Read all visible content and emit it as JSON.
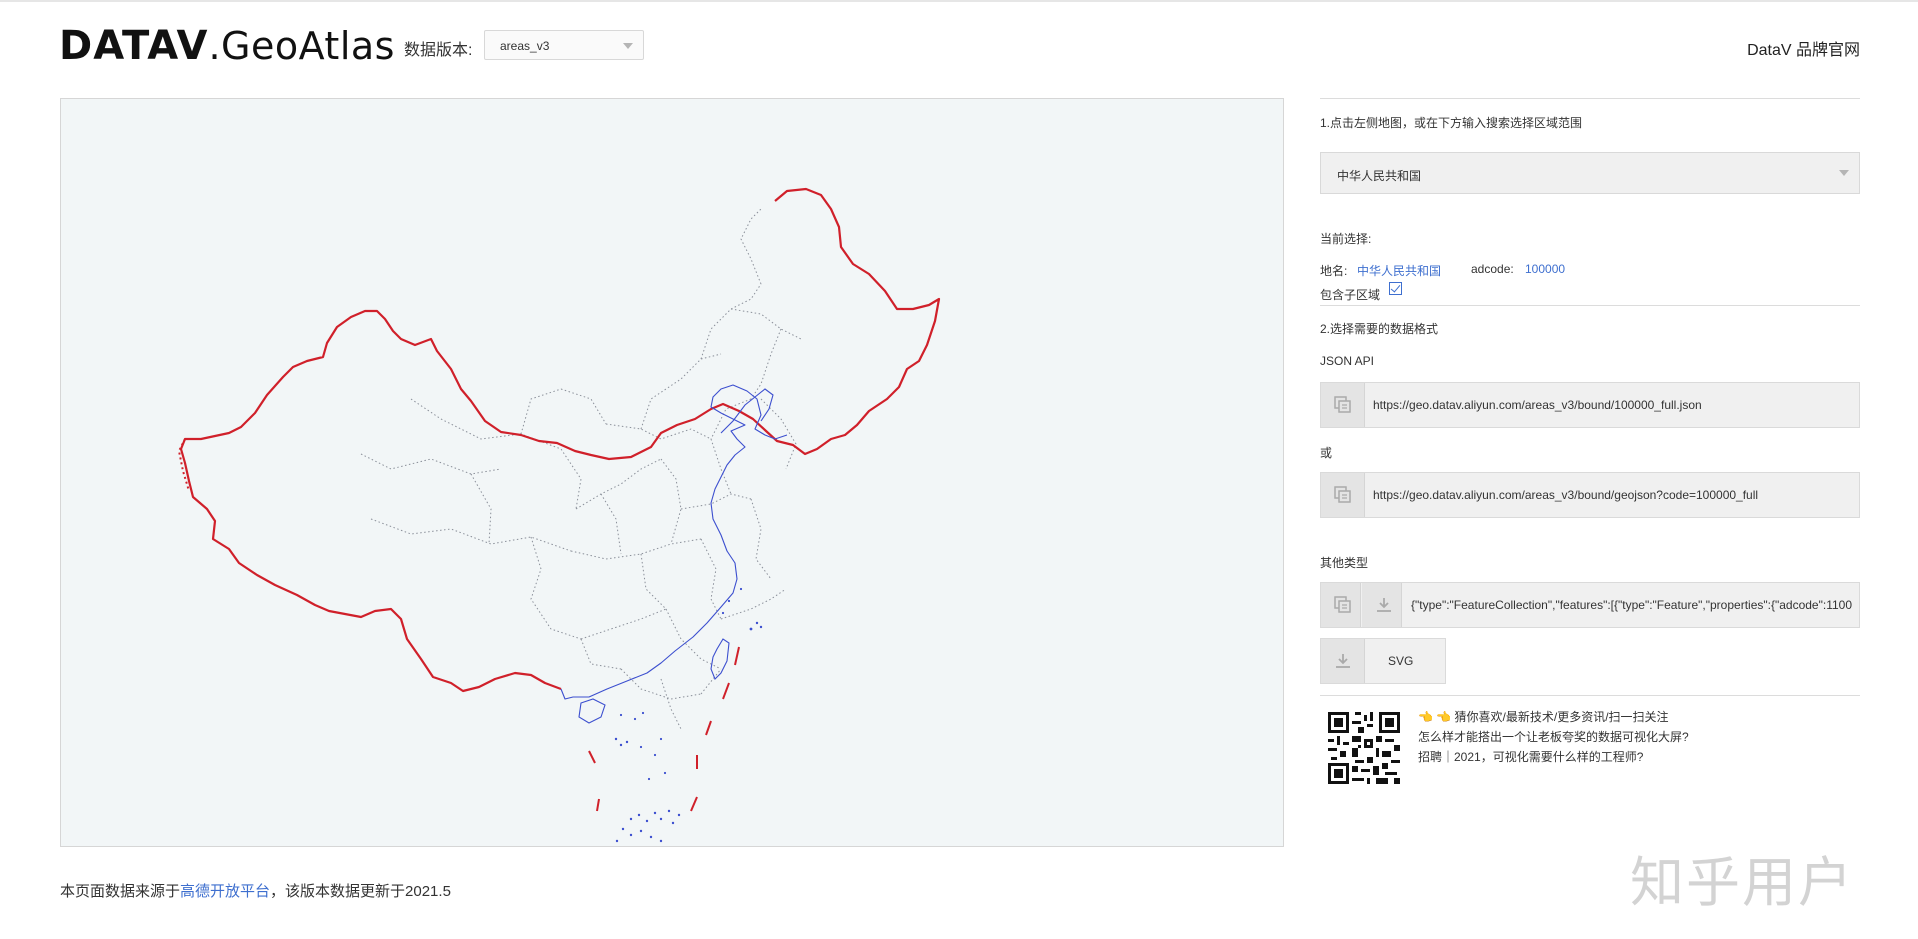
{
  "header": {
    "logo_bold": "DATAV",
    "logo_light": ".GeoAtlas",
    "version_label": "数据版本:",
    "version_value": "areas_v3",
    "brand_link": "DataV 品牌官网"
  },
  "panel": {
    "step1": "1.点击左侧地图，或在下方输入搜索选择区域范围",
    "region_value": "中华人民共和国",
    "current_label": "当前选择:",
    "name_label": "地名:",
    "name_value": "中华人民共和国",
    "adcode_label": "adcode:",
    "adcode_value": "100000",
    "include_children_label": "包含子区域",
    "include_children_checked": true,
    "step2": "2.选择需要的数据格式",
    "json_api_label": "JSON API",
    "url1": "https://geo.datav.aliyun.com/areas_v3/bound/100000_full.json",
    "or_label": "或",
    "url2": "https://geo.datav.aliyun.com/areas_v3/bound/geojson?code=100000_full",
    "other_types_label": "其他类型",
    "geojson_preview": "{\"type\":\"FeatureCollection\",\"features\":[{\"type\":\"Feature\",\"properties\":{\"adcode\":1100",
    "svg_label": "SVG"
  },
  "news": {
    "line1": "👈 👈 猜你喜欢/最新技术/更多资讯/扫一扫关注",
    "line2": "怎么样才能搭出一个让老板夸奖的数据可视化大屏?",
    "line3": "招聘｜2021，可视化需要什么样的工程师?"
  },
  "footer": {
    "prefix": "本页面数据来源于",
    "link": "高德开放平台",
    "suffix": "，该版本数据更新于2021.5"
  },
  "watermark": "知乎用户",
  "colors": {
    "border_red": "#d0202a",
    "coast_blue": "#3c4fcf",
    "province_gray": "#8a8f99",
    "link_blue": "#3e6fcf",
    "map_bg": "#f2f6f7"
  }
}
